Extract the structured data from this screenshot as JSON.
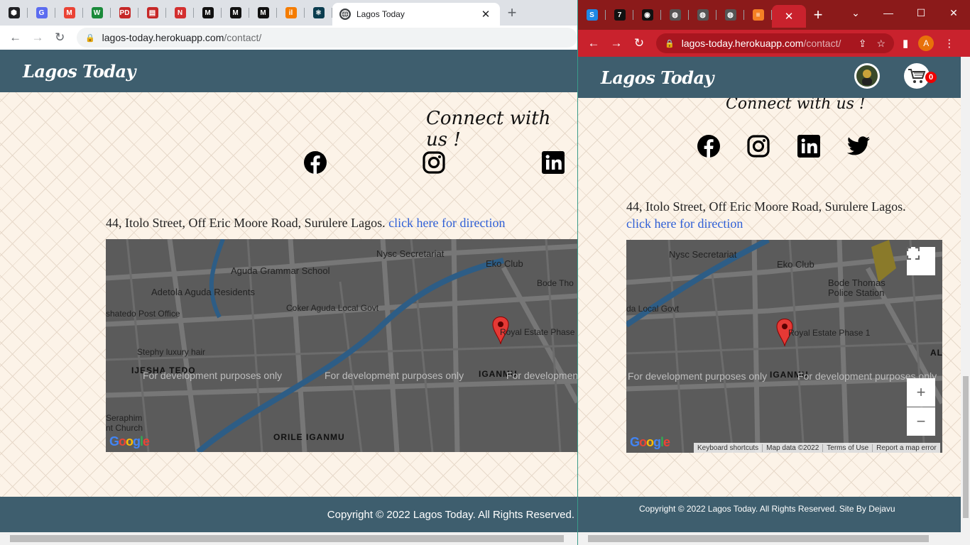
{
  "left_window": {
    "pinned_tabs": [
      {
        "icon": "hex-icon",
        "color": "#202124",
        "glyph": "⬢"
      },
      {
        "icon": "chrome-badge-icon",
        "color": "#5b6cf0",
        "glyph": "G"
      },
      {
        "icon": "gmail-icon",
        "color": "#ea4335",
        "glyph": "M"
      },
      {
        "icon": "w-icon",
        "color": "#1a8a3a",
        "glyph": "W"
      },
      {
        "icon": "pd-icon",
        "color": "#c62828",
        "glyph": "PD"
      },
      {
        "icon": "slides-icon",
        "color": "#c62828",
        "glyph": "▤"
      },
      {
        "icon": "n-icon",
        "color": "#d32f2f",
        "glyph": "N"
      },
      {
        "icon": "medium-icon",
        "color": "#111",
        "glyph": "M"
      },
      {
        "icon": "medium-icon",
        "color": "#111",
        "glyph": "M"
      },
      {
        "icon": "medium-icon",
        "color": "#111",
        "glyph": "M"
      },
      {
        "icon": "bar-icon",
        "color": "#f57c00",
        "glyph": "il"
      },
      {
        "icon": "react-icon",
        "color": "#0b3d4f",
        "glyph": "⚛"
      }
    ],
    "active_tab_title": "Lagos Today",
    "url_host": "lagos-today.herokuapp.com",
    "url_path": "/contact/"
  },
  "right_window": {
    "pinned_tabs": [
      {
        "icon": "s-icon",
        "color": "#1e88e5",
        "glyph": "S"
      },
      {
        "icon": "seven-icon",
        "color": "#111",
        "glyph": "7"
      },
      {
        "icon": "github-icon",
        "color": "#111",
        "glyph": "◉"
      },
      {
        "icon": "globe-icon",
        "color": "#555",
        "glyph": "◍"
      },
      {
        "icon": "globe-icon",
        "color": "#555",
        "glyph": "◍"
      },
      {
        "icon": "globe-icon",
        "color": "#555",
        "glyph": "◍"
      },
      {
        "icon": "stack-icon",
        "color": "#f48024",
        "glyph": "≡"
      }
    ],
    "url_host": "lagos-today.herokuapp.com",
    "url_path": "/contact/",
    "profile_initial": "A",
    "cart_count": "0"
  },
  "site": {
    "logo": "Lagos Today",
    "connect_heading": "Connect with us !",
    "social": [
      "facebook",
      "instagram",
      "linkedin",
      "twitter"
    ],
    "address": "44, Itolo Street, Off Eric Moore Road, Surulere Lagos.",
    "direction_link": "click here for direction",
    "footer_left": "Copyright © 2022 Lagos Today. All Rights Reserved.",
    "footer_right": "Copyright © 2022 Lagos Today. All Rights Reserved. Site By Dejavu"
  },
  "map": {
    "dev_notice": "For development purposes only",
    "left_labels": [
      "Nysc Secretariat",
      "Eko Club",
      "Aguda Grammar School",
      "Adetola Aguda Residents",
      "Bode Tho",
      "Coker Aguda Local Govt",
      "shatedo Post Office",
      "Royal Estate Phase",
      "Stephy luxury hair",
      "IJESHA TEDO",
      "IGANMU",
      "Seraphim",
      "nt Church",
      "ORILE IGANMU"
    ],
    "right_labels": [
      "Nysc Secretariat",
      "Eko Club",
      "Bode Thomas",
      "Police Station",
      "da Local Govt",
      "Royal Estate Phase 1",
      "IGANMU",
      "ALA"
    ],
    "keyboard_shortcuts": "Keyboard shortcuts",
    "map_data": "Map data ©2022",
    "terms": "Terms of Use",
    "report": "Report a map error",
    "zoom_in": "+",
    "zoom_out": "−"
  }
}
